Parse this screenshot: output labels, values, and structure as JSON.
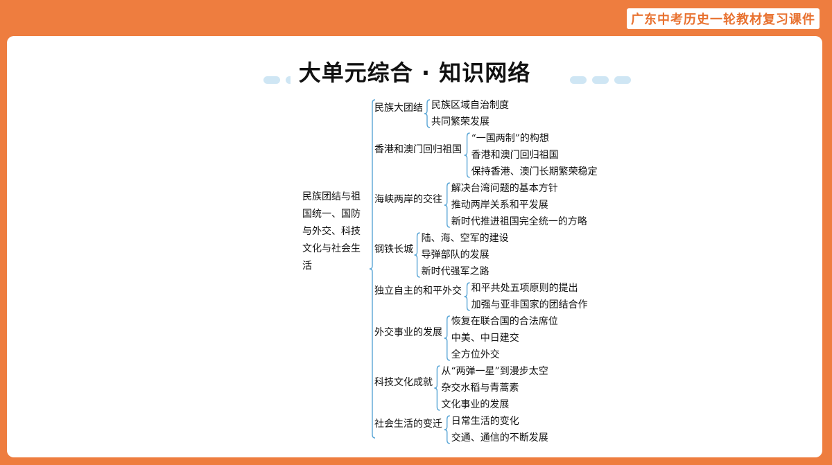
{
  "header": {
    "course_label": "广东中考历史一轮教材复习课件"
  },
  "page": {
    "title": "大单元综合 · 知识网络"
  },
  "colors": {
    "frame": "#ee7d3f",
    "bracket": "#5aa6d6",
    "dash": "#cfe6f4"
  },
  "mindmap": {
    "root": "民族团结与祖国统一、国防与外交、科技文化与社会生活",
    "branches": [
      {
        "label": "民族大团结",
        "items": [
          "民族区域自治制度",
          "共同繁荣发展"
        ]
      },
      {
        "label": "香港和澳门回归祖国",
        "items": [
          "“一国两制”的构想",
          "香港和澳门回归祖国",
          "保持香港、澳门长期繁荣稳定"
        ]
      },
      {
        "label": "海峡两岸的交往",
        "items": [
          "解决台湾问题的基本方针",
          "推动两岸关系和平发展",
          "新时代推进祖国完全统一的方略"
        ]
      },
      {
        "label": "钢铁长城",
        "items": [
          "陆、海、空军的建设",
          "导弹部队的发展",
          "新时代强军之路"
        ]
      },
      {
        "label": "独立自主的和平外交",
        "items": [
          "和平共处五项原则的提出",
          "加强与亚非国家的团结合作"
        ]
      },
      {
        "label": "外交事业的发展",
        "items": [
          "恢复在联合国的合法席位",
          "中美、中日建交",
          "全方位外交"
        ]
      },
      {
        "label": "科技文化成就",
        "items": [
          "从“两弹一星”到漫步太空",
          "杂交水稻与青蒿素",
          "文化事业的发展"
        ]
      },
      {
        "label": "社会生活的变迁",
        "items": [
          "日常生活的变化",
          "交通、通信的不断发展"
        ]
      }
    ]
  }
}
